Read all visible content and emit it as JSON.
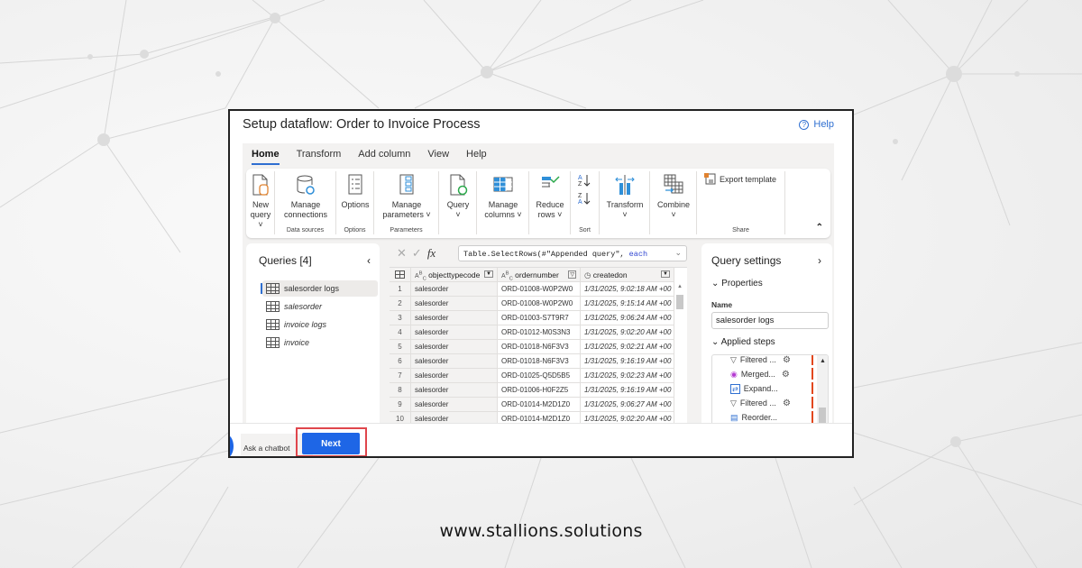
{
  "window": {
    "title": "Setup dataflow: Order to Invoice Process",
    "help_label": "Help"
  },
  "ribbon": {
    "tabs": [
      {
        "label": "Home",
        "active": true
      },
      {
        "label": "Transform",
        "active": false
      },
      {
        "label": "Add column",
        "active": false
      },
      {
        "label": "View",
        "active": false
      },
      {
        "label": "Help",
        "active": false
      }
    ],
    "buttons": {
      "new_query": {
        "line1": "New",
        "line2": "query ˅",
        "icon": "new-query-icon"
      },
      "manage_connections": {
        "line1": "Manage",
        "line2": "connections",
        "icon": "manage-connections-icon"
      },
      "options": {
        "line1": "Options",
        "icon": "options-icon"
      },
      "manage_parameters": {
        "line1": "Manage",
        "line2": "parameters ˅",
        "icon": "manage-parameters-icon"
      },
      "query": {
        "line1": "Query",
        "line2": "˅",
        "icon": "refresh-query-icon"
      },
      "manage_columns": {
        "line1": "Manage",
        "line2": "columns ˅",
        "icon": "manage-columns-icon"
      },
      "reduce_rows": {
        "line1": "Reduce",
        "line2": "rows ˅",
        "icon": "reduce-rows-icon"
      },
      "sort_asc": {
        "icon": "sort-ascending-icon"
      },
      "sort_desc": {
        "icon": "sort-descending-icon"
      },
      "transform": {
        "line1": "Transform",
        "line2": "˅",
        "icon": "transform-icon"
      },
      "combine": {
        "line1": "Combine",
        "line2": "˅",
        "icon": "combine-icon"
      },
      "export_template": {
        "label": "Export template",
        "icon": "export-template-icon"
      }
    },
    "groups": {
      "data_sources": "Data sources",
      "options": "Options",
      "parameters": "Parameters",
      "sort": "Sort",
      "share": "Share"
    }
  },
  "queries": {
    "title": "Queries [4]",
    "items": [
      {
        "label": "salesorder logs",
        "active": true
      },
      {
        "label": "salesorder",
        "active": false
      },
      {
        "label": "invoice logs",
        "active": false
      },
      {
        "label": "invoice",
        "active": false
      }
    ]
  },
  "formula_bar": {
    "prefix": "Table.SelectRows(#\"Appended query\", ",
    "keyword": "each"
  },
  "grid": {
    "columns": [
      {
        "label": "objecttypecode",
        "type": "text"
      },
      {
        "label": "ordernumber",
        "type": "text"
      },
      {
        "label": "createdon",
        "type": "datetimezone"
      }
    ],
    "rows": [
      {
        "n": "1",
        "objecttypecode": "salesorder",
        "ordernumber": "ORD-01008-W0P2W0",
        "createdon": "1/31/2025, 9:02:18 AM +00"
      },
      {
        "n": "2",
        "objecttypecode": "salesorder",
        "ordernumber": "ORD-01008-W0P2W0",
        "createdon": "1/31/2025, 9:15:14 AM +00"
      },
      {
        "n": "3",
        "objecttypecode": "salesorder",
        "ordernumber": "ORD-01003-S7T9R7",
        "createdon": "1/31/2025, 9:06:24 AM +00"
      },
      {
        "n": "4",
        "objecttypecode": "salesorder",
        "ordernumber": "ORD-01012-M0S3N3",
        "createdon": "1/31/2025, 9:02:20 AM +00"
      },
      {
        "n": "5",
        "objecttypecode": "salesorder",
        "ordernumber": "ORD-01018-N6F3V3",
        "createdon": "1/31/2025, 9:02:21 AM +00"
      },
      {
        "n": "6",
        "objecttypecode": "salesorder",
        "ordernumber": "ORD-01018-N6F3V3",
        "createdon": "1/31/2025, 9:16:19 AM +00"
      },
      {
        "n": "7",
        "objecttypecode": "salesorder",
        "ordernumber": "ORD-01025-Q5D5B5",
        "createdon": "1/31/2025, 9:02:23 AM +00"
      },
      {
        "n": "8",
        "objecttypecode": "salesorder",
        "ordernumber": "ORD-01006-H0F2Z5",
        "createdon": "1/31/2025, 9:16:19 AM +00"
      },
      {
        "n": "9",
        "objecttypecode": "salesorder",
        "ordernumber": "ORD-01014-M2D1Z0",
        "createdon": "1/31/2025, 9:06:27 AM +00"
      },
      {
        "n": "10",
        "objecttypecode": "salesorder",
        "ordernumber": "ORD-01014-M2D1Z0",
        "createdon": "1/31/2025, 9:02:20 AM +00"
      }
    ]
  },
  "query_settings": {
    "title": "Query settings",
    "properties_label": "Properties",
    "name_label": "Name",
    "name_value": "salesorder logs",
    "applied_steps_label": "Applied steps",
    "steps": [
      {
        "label": "Filtered ...",
        "icon": "filter-icon",
        "has_gear": true
      },
      {
        "label": "Merged...",
        "icon": "merge-icon",
        "has_gear": true
      },
      {
        "label": "Expand...",
        "icon": "expand-icon",
        "has_gear": false
      },
      {
        "label": "Filtered ...",
        "icon": "filter-icon",
        "has_gear": true
      },
      {
        "label": "Reorder...",
        "icon": "reorder-icon",
        "has_gear": false
      }
    ]
  },
  "footer": {
    "chatbot_label": "Ask a chatbot",
    "next_label": "Next"
  },
  "colors": {
    "accent": "#1e66e6",
    "highlight_outline": "#e0464c",
    "step_warning": "#e2471d"
  },
  "site_url": "www.stallions.solutions"
}
